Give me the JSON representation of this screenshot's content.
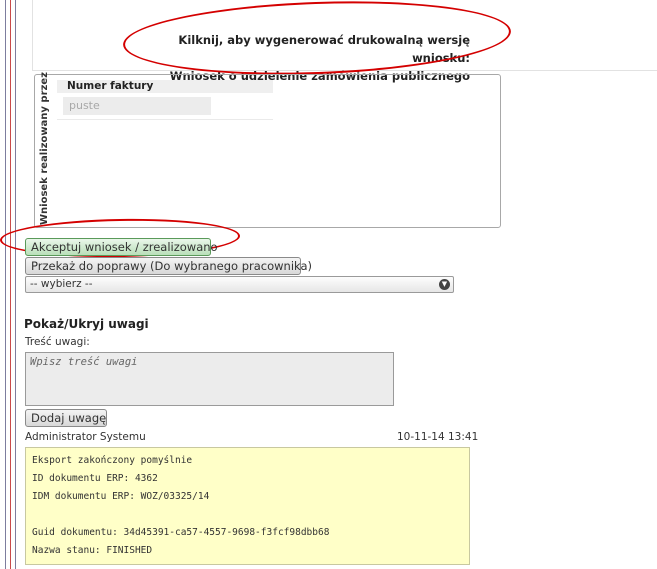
{
  "print": {
    "line1": "Kilknij, aby wygenerować drukowalną wersję wniosku:",
    "line2": "Wniosek o udzielenie zamówienia publicznego"
  },
  "fieldset": {
    "legend": "Wniosek realizowany przez",
    "invoice_header": "Numer faktury",
    "invoice_empty": "puste"
  },
  "actions": {
    "accept_label": "Akceptuj wniosek / zrealizowano",
    "return_label": "Przekaż do poprawy (Do wybranego pracownika)",
    "select_value": "-- wybierz --"
  },
  "notes": {
    "toggle_label": "Pokaż/Ukryj uwagi",
    "content_label": "Treść uwagi:",
    "placeholder": "Wpisz treść uwagi",
    "add_label": "Dodaj uwagę"
  },
  "comment": {
    "author": "Administrator Systemu",
    "timestamp": "10-11-14 13:41",
    "lines": [
      "Eksport zakończony pomyślnie",
      "ID dokumentu ERP: 4362",
      "IDM dokumentu ERP: WOZ/03325/14",
      "",
      "Guid dokumentu: 34d45391-ca57-4557-9698-f3fcf98dbb68",
      "Nazwa stanu: FINISHED"
    ]
  },
  "colors": {
    "annotation_red": "#d40000",
    "comment_bg": "#ffffc8",
    "accept_green": "#b9dfb9"
  }
}
